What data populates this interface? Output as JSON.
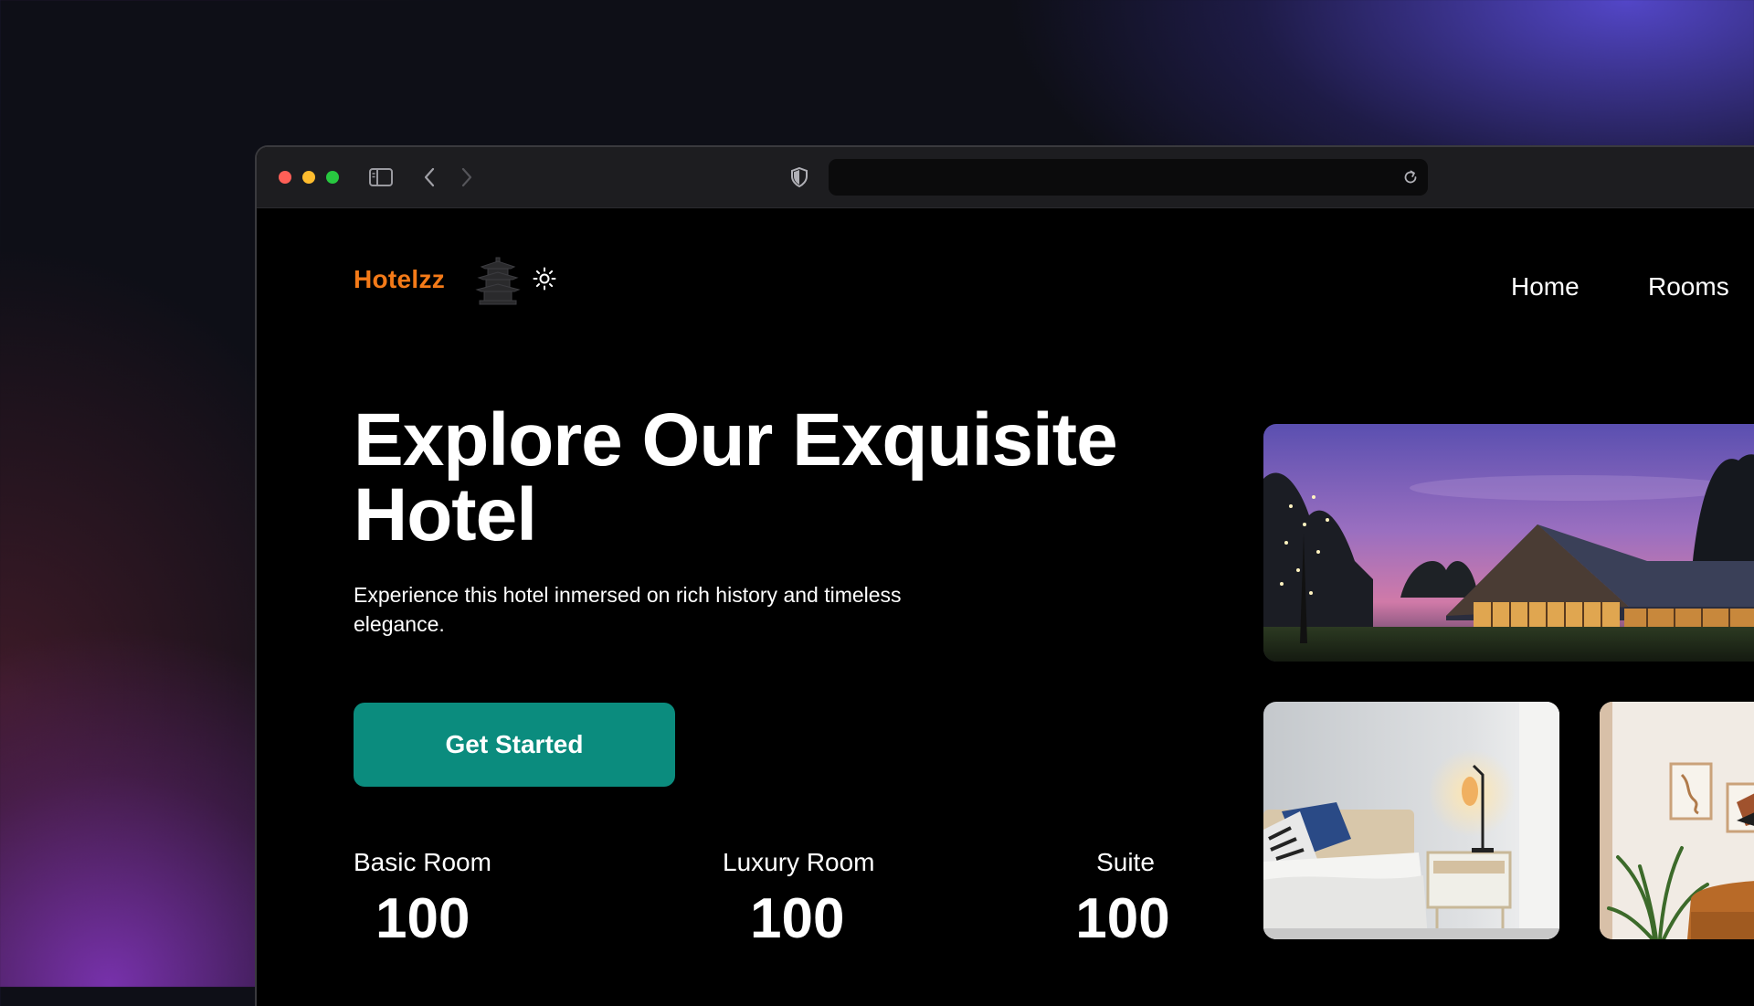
{
  "browser": {
    "icons": [
      "sidebar-icon",
      "chevron-left-icon",
      "chevron-right-icon",
      "shield-icon",
      "reload-icon"
    ],
    "url": ""
  },
  "header": {
    "brand": "Hotelzz",
    "logo_icon": "pagoda-icon",
    "theme_icon": "sun-icon",
    "nav": [
      {
        "label": "Home"
      },
      {
        "label": "Rooms"
      }
    ]
  },
  "hero": {
    "title": "Explore Our Exquisite Hotel",
    "subtitle": "Experience this hotel inmersed on rich history and timeless elegance.",
    "cta_label": "Get Started"
  },
  "stats": [
    {
      "label": "Basic Room",
      "value": "100"
    },
    {
      "label": "Luxury Room",
      "value": "100"
    },
    {
      "label": "Suite",
      "value": "100"
    }
  ],
  "colors": {
    "brand": "#f47a18",
    "cta": "#0b8c7e",
    "page_bg": "#000000",
    "toolbar_bg": "#1d1d20"
  }
}
